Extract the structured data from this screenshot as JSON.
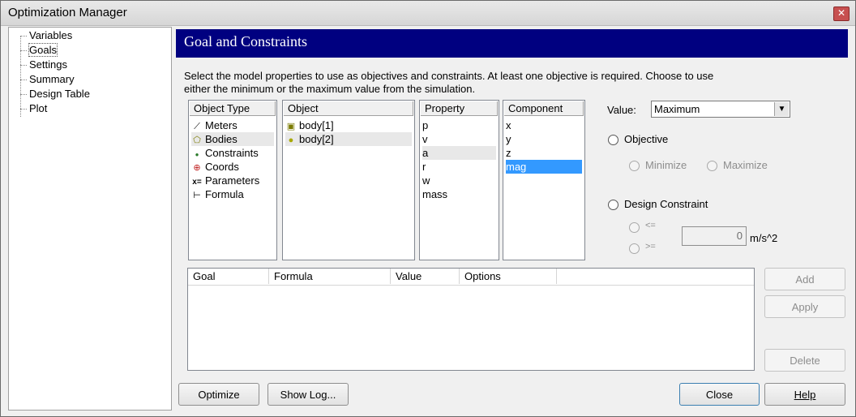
{
  "window": {
    "title": "Optimization Manager",
    "close_glyph": "✕"
  },
  "tree": {
    "items": [
      "Variables",
      "Goals",
      "Settings",
      "Summary",
      "Design Table",
      "Plot"
    ],
    "selected": "Goals"
  },
  "panel": {
    "title": "Goal and Constraints",
    "description": "Select the model properties to use as objectives and constraints. At least one objective is required. Choose to use either the minimum or the maximum value from the simulation."
  },
  "lists": {
    "object_type": {
      "header": "Object Type",
      "items": [
        {
          "label": "Meters",
          "icon": "meters-icon",
          "glyph": "⟋"
        },
        {
          "label": "Bodies",
          "icon": "bodies-icon",
          "glyph": "⬠"
        },
        {
          "label": "Constraints",
          "icon": "constraints-icon",
          "glyph": "●"
        },
        {
          "label": "Coords",
          "icon": "coords-icon",
          "glyph": "⊕"
        },
        {
          "label": "Parameters",
          "icon": "parameters-icon",
          "glyph": "x="
        },
        {
          "label": "Formula",
          "icon": "formula-icon",
          "glyph": "⊢"
        }
      ],
      "selected": "Bodies"
    },
    "object": {
      "header": "Object",
      "items": [
        {
          "label": "body[1]",
          "icon": "body-icon",
          "glyph": "▣"
        },
        {
          "label": "body[2]",
          "icon": "body-icon",
          "glyph": "●"
        }
      ],
      "selected": "body[2]"
    },
    "property": {
      "header": "Property",
      "items": [
        "p",
        "v",
        "a",
        "r",
        "w",
        "mass"
      ],
      "selected": "a"
    },
    "component": {
      "header": "Component",
      "items": [
        "x",
        "y",
        "z",
        "mag"
      ],
      "selected": "mag"
    }
  },
  "value": {
    "label": "Value:",
    "selected": "Maximum"
  },
  "objective": {
    "label": "Objective",
    "minimize": "Minimize",
    "maximize": "Maximize"
  },
  "constraint": {
    "label": "Design Constraint",
    "le": "<=",
    "ge": ">=",
    "limit": "0",
    "unit": "m/s^2"
  },
  "goal_table": {
    "columns": [
      "Goal",
      "Formula",
      "Value",
      "Options"
    ]
  },
  "buttons": {
    "add": "Add",
    "apply": "Apply",
    "delete": "Delete",
    "optimize": "Optimize",
    "show_log": "Show Log...",
    "close": "Close",
    "help": "Help"
  }
}
